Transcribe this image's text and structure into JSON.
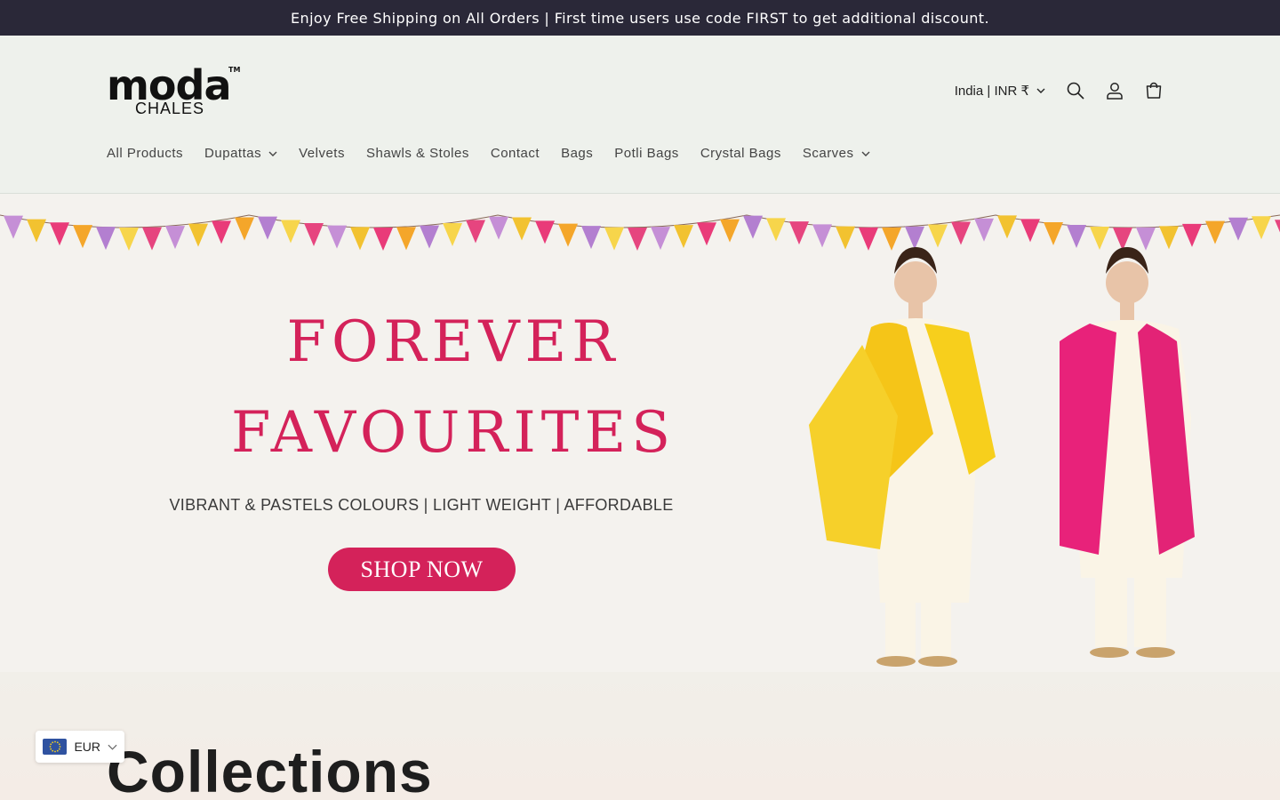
{
  "announcement": "Enjoy Free Shipping on All Orders | First time users use code FIRST to get additional discount.",
  "logo": {
    "main": "moda",
    "sub": "CHALES",
    "tm": "TM"
  },
  "header": {
    "country": "India | INR ₹",
    "icons": [
      "search-icon",
      "account-icon",
      "cart-icon"
    ]
  },
  "nav": [
    {
      "label": "All Products",
      "dropdown": false
    },
    {
      "label": "Dupattas",
      "dropdown": true
    },
    {
      "label": "Velvets",
      "dropdown": false
    },
    {
      "label": "Shawls & Stoles",
      "dropdown": false
    },
    {
      "label": "Contact",
      "dropdown": false
    },
    {
      "label": "Bags",
      "dropdown": false
    },
    {
      "label": "Potli Bags",
      "dropdown": false
    },
    {
      "label": "Crystal Bags",
      "dropdown": false
    },
    {
      "label": "Scarves",
      "dropdown": true
    }
  ],
  "hero": {
    "title_line1": "FOREVER",
    "title_line2": "FAVOURITES",
    "subtitle": "VIBRANT &  PASTELS COLOURS  |  LIGHT WEIGHT | AFFORDABLE",
    "button": "SHOP NOW",
    "accent_color": "#d4225a"
  },
  "collections": {
    "title": "Collections"
  },
  "currency_selector": {
    "code": "EUR"
  }
}
